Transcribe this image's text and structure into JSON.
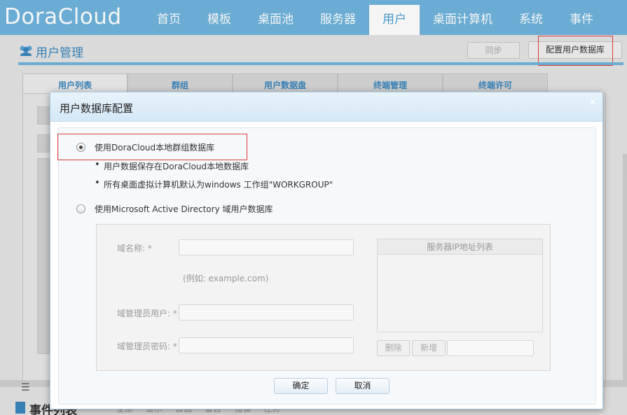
{
  "app": {
    "logo_text": "DoraCloud"
  },
  "nav": {
    "items": [
      {
        "label": "首页"
      },
      {
        "label": "模板"
      },
      {
        "label": "桌面池"
      },
      {
        "label": "服务器"
      },
      {
        "label": "用户"
      },
      {
        "label": "桌面计算机"
      },
      {
        "label": "系统"
      },
      {
        "label": "事件"
      }
    ],
    "active": "用户"
  },
  "page": {
    "title": "用户管理",
    "sync_label": "同步",
    "config_db_label": "配置用户数据库",
    "tabs": [
      {
        "label": "用户列表"
      },
      {
        "label": "群组"
      },
      {
        "label": "用户数据盘"
      },
      {
        "label": "终端管理"
      },
      {
        "label": "终端许可"
      }
    ],
    "events_title": "事件列表",
    "events_filters": [
      "全部",
      "显示",
      "普通",
      "警告",
      "错误",
      "任务"
    ]
  },
  "dialog": {
    "title": "用户数据库配置",
    "close_glyph": "×",
    "option_local": {
      "label": "使用DoraCloud本地群组数据库",
      "selected": true,
      "bullets": [
        "用户数据保存在DoraCloud本地数据库",
        "所有桌面虚拟计算机默认为windows 工作组\"WORKGROUP\""
      ]
    },
    "option_ad": {
      "label": "使用Microsoft Active Directory 域用户数据库",
      "selected": false
    },
    "ad_form": {
      "domain_label": "域名称: *",
      "domain_value": "",
      "domain_hint": "(例如: example.com)",
      "admin_user_label": "域管理员用户: *",
      "admin_user_value": "",
      "admin_pass_label": "域管理员密码: *",
      "admin_pass_value": "",
      "ip_list_header": "服务器IP地址列表",
      "delete_label": "删除",
      "add_label": "新增",
      "ip_input_value": ""
    },
    "ok_label": "确定",
    "cancel_label": "取消"
  },
  "colors": {
    "nav_bg": "#6fb3dc",
    "accent": "#3a86bd",
    "highlight_box": "#e03c3c"
  }
}
